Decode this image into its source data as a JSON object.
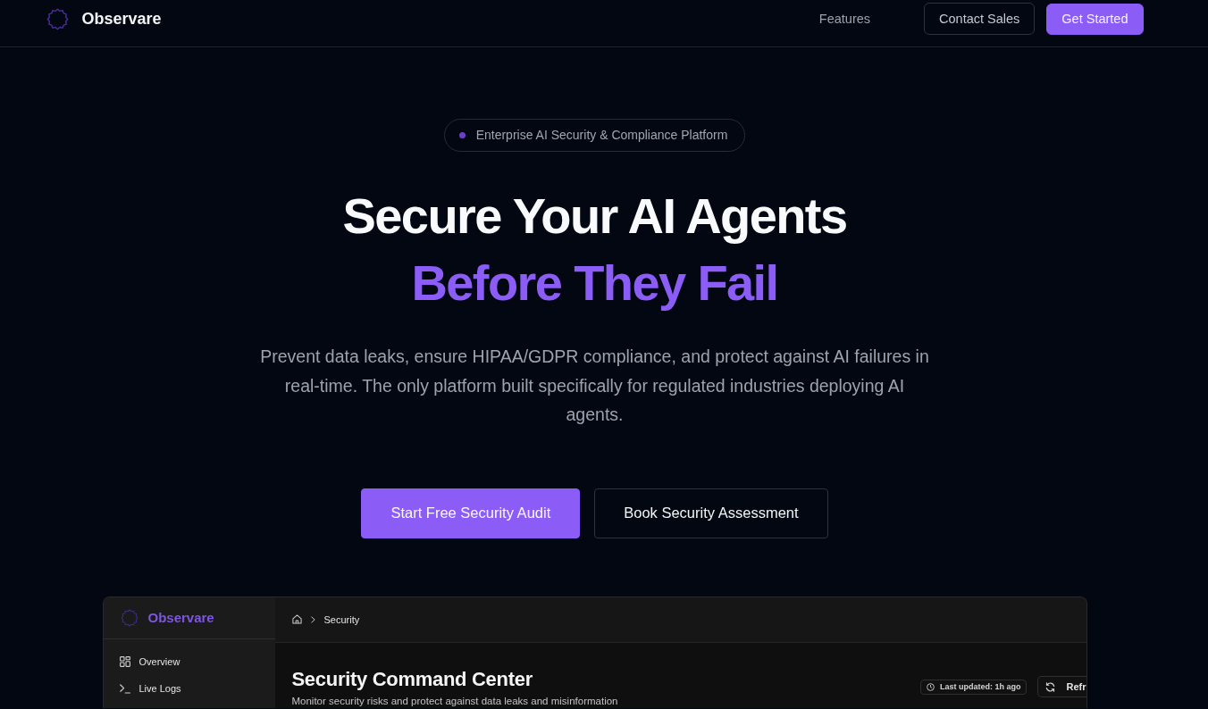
{
  "header": {
    "brand": "Observare",
    "nav": [
      {
        "label": "Features"
      }
    ],
    "actions": [
      {
        "label": "Contact Sales",
        "kind": "outline"
      },
      {
        "label": "Get Started",
        "kind": "primary"
      }
    ]
  },
  "hero": {
    "badge": "Enterprise AI Security & Compliance Platform",
    "title": "Secure Your AI Agents",
    "highlight": "Before They Fail",
    "description": "Prevent data leaks, ensure HIPAA/GDPR compliance, and protect against AI failures in real-time. The only platform built specifically for regulated industries deploying AI agents.",
    "actions": [
      {
        "label": "Start Free Security Audit",
        "kind": "primary"
      },
      {
        "label": "Book Security Assessment",
        "kind": "outline"
      }
    ]
  },
  "preview": {
    "brand": "Observare",
    "sidebar": {
      "items": [
        {
          "label": "Overview"
        },
        {
          "label": "Live Logs"
        }
      ]
    },
    "breadcrumb": [
      "Security"
    ],
    "title": "Security Command Center",
    "subtitle": "Monitor security risks and protect against data leaks and misinformation",
    "last_updated": "Last updated: 1h ago",
    "refresh": "Refr"
  }
}
